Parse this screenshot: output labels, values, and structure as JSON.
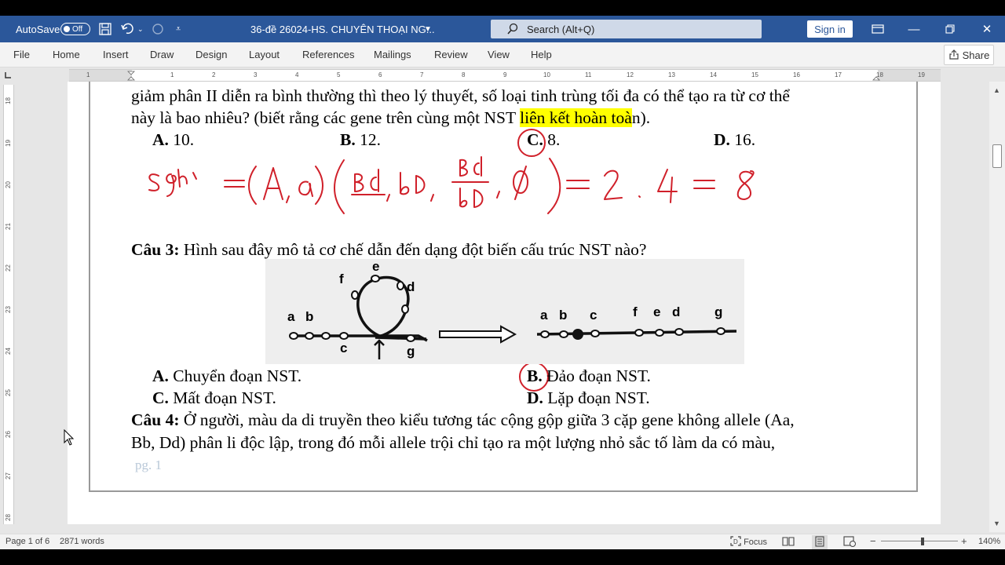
{
  "titlebar": {
    "autosave_label": "AutoSave",
    "autosave_state": "Off",
    "doc_title": "36-đề 26024-HS. CHUYÊN THOẠI NG...",
    "search_placeholder": "Search (Alt+Q)",
    "signin_label": "Sign in"
  },
  "ribbon": {
    "tabs": [
      "File",
      "Home",
      "Insert",
      "Draw",
      "Design",
      "Layout",
      "References",
      "Mailings",
      "Review",
      "View",
      "Help"
    ],
    "share_label": "Share"
  },
  "ruler": {
    "h_numbers": [
      "1",
      "1",
      "2",
      "3",
      "4",
      "5",
      "6",
      "7",
      "8",
      "9",
      "10",
      "11",
      "12",
      "13",
      "14",
      "15",
      "16",
      "17",
      "18",
      "19"
    ],
    "v_numbers": [
      "18",
      "19",
      "20",
      "21",
      "22",
      "23",
      "24",
      "25",
      "26",
      "27",
      "28"
    ]
  },
  "doc": {
    "line1": "giảm phân II diễn ra bình thường thì theo lý thuyết, số loại tinh trùng tối đa có thể tạo ra từ cơ thể",
    "line2_pre": "này là bao nhiêu? (biết rằng các gene trên cùng một NST ",
    "line2_hl": "liên kết hoàn toà",
    "line2_post": "n).",
    "q2_options": [
      {
        "letter": "A.",
        "text": " 10."
      },
      {
        "letter": "B.",
        "text": " 12."
      },
      {
        "letter": "C.",
        "text": " 8."
      },
      {
        "letter": "D.",
        "text": " 16."
      }
    ],
    "q3_label": "Câu 3:",
    "q3_text": " Hình sau đây mô tả cơ chế dẫn đến dạng đột biến cấu trúc NST nào?",
    "q3_options": [
      {
        "letter": "A.",
        "text": " Chuyển đoạn NST."
      },
      {
        "letter": "B.",
        "text": " Đảo đoạn NST."
      },
      {
        "letter": "C.",
        "text": " Mất đoạn NST."
      },
      {
        "letter": "D.",
        "text": " Lặp đoạn NST."
      }
    ],
    "q4_label": "Câu 4:",
    "q4_line1": " Ở người, màu da di truyền theo kiểu tương tác cộng gộp giữa 3 cặp gene không allele (Aa,",
    "q4_line2": "Bb, Dd) phân li độc lập, trong đó mỗi allele trội chỉ tạo ra một lượng nhỏ sắc tố làm da có màu,",
    "page_watermark": "pg. 1",
    "figure_labels": {
      "a1": "a",
      "b1": "b",
      "c1": "c",
      "d1": "d",
      "e1": "e",
      "f1": "f",
      "g1": "g",
      "a2": "a",
      "b2": "b",
      "c2": "c",
      "f2": "f",
      "e2": "e",
      "d2": "d",
      "g2": "g"
    }
  },
  "statusbar": {
    "page_info": "Page 1 of 6",
    "word_count": "2871 words",
    "focus_label": "Focus",
    "zoom": "140%"
  },
  "colors": {
    "titlebar": "#2b579a",
    "highlight": "#ffff00",
    "ink": "#d0202a"
  }
}
